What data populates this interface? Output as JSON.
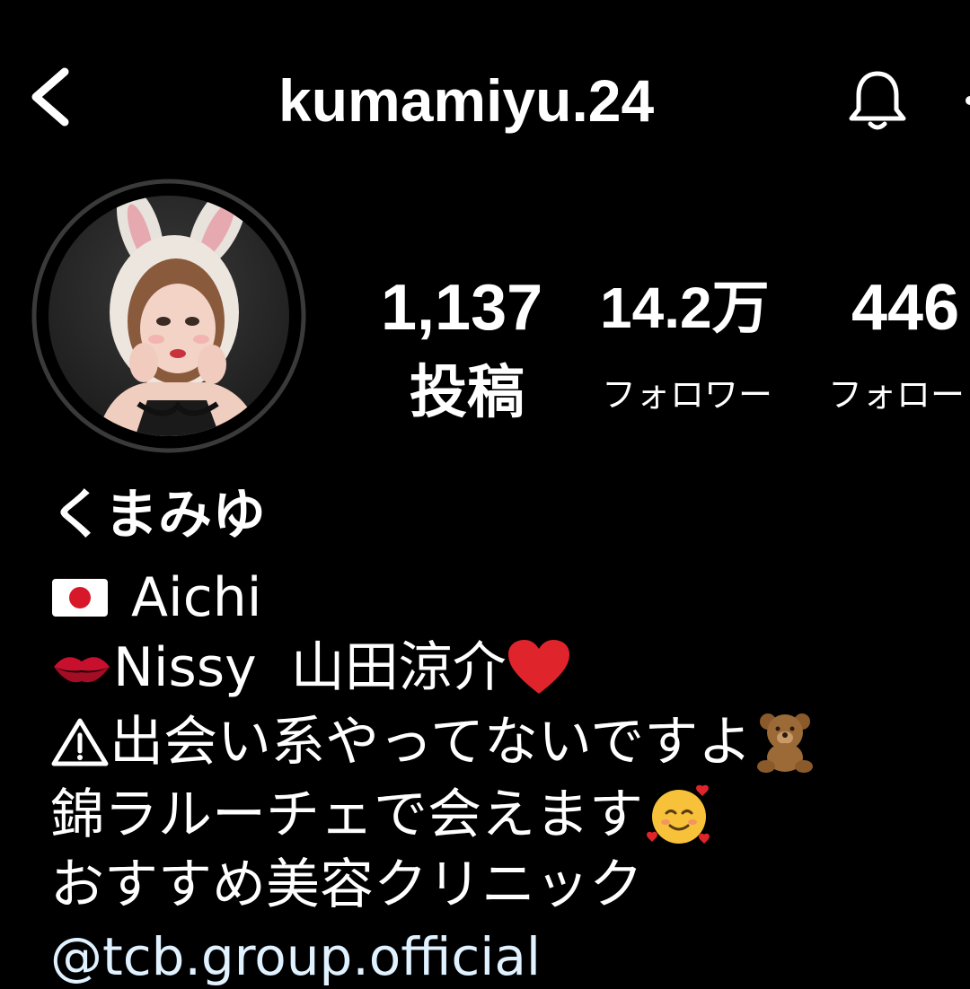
{
  "header": {
    "username": "kumamiyu.24",
    "back_icon": "chevron-left-icon",
    "bell_icon": "bell-icon",
    "more_icon": "more-dots-icon"
  },
  "profile": {
    "avatar": "profile-photo-bunny-ears-hood"
  },
  "stats": {
    "posts_count": "1,137",
    "posts_label": "投稿",
    "followers_count": "14.2万",
    "followers_label": "フォロワー",
    "following_count": "446",
    "following_label": "フォロー"
  },
  "bio": {
    "name": "くまみゆ",
    "location_flag": "japan-flag-icon",
    "location": "Aichi",
    "like_icon": "kiss-lips-icon",
    "like_text": "Nissy  山田涼介",
    "like_heart": "red-heart-icon",
    "warning_icon": "warning-icon",
    "warning_text": "出会い系やってないですよ",
    "warning_bear": "teddy-bear-icon",
    "shop_text": "錦ラルーチェで会えます",
    "shop_emoji": "smiling-face-with-hearts-icon",
    "clinic_text": "おすすめ美容クリニック",
    "link": "@tcb.group.official"
  },
  "colors": {
    "background": "#000000",
    "text": "#ffffff",
    "link": "#e0f1ff",
    "heart": "#e0242b"
  }
}
